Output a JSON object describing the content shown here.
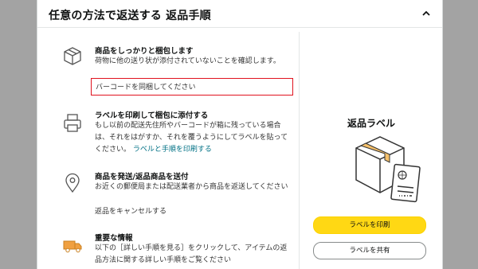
{
  "header": {
    "title": "任意の方法で返送する 返品手順"
  },
  "steps": [
    {
      "title": "商品をしっかりと梱包します",
      "body": "荷物に他の送り状が添付されていないことを確認します。",
      "highlight": "バーコードを同梱してください"
    },
    {
      "title": "ラベルを印刷して梱包に添付する",
      "body": "もし以前の配送先住所やバーコードが箱に残っている場合は、それをはがすか、それを覆うようにしてラベルを貼ってください。",
      "link": "ラベルと手順を印刷する"
    },
    {
      "title": "商品を発送/返品商品を送付",
      "body": "お近くの郵便局または配送業者から商品を返送してください",
      "link": "返品をキャンセルする"
    },
    {
      "title": "重要な情報",
      "body": "以下の［詳しい手順を見る］をクリックして、アイテムの返品方法に関する詳しい手順をご覧ください"
    }
  ],
  "label_panel": {
    "title": "返品ラベル",
    "print_button": "ラベルを印刷",
    "share_button": "ラベルを共有"
  },
  "colors": {
    "accent_yellow": "#ffd814",
    "link": "#007185",
    "highlight_border": "#e0121e"
  }
}
